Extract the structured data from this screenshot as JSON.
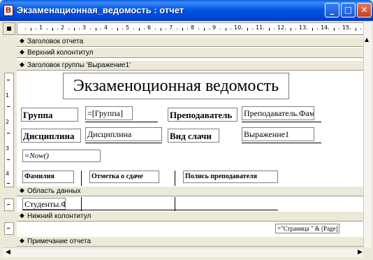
{
  "window": {
    "title": "Экзаменационная_ведомость : отчет",
    "icon_letter": "B",
    "minimize_glyph": "_",
    "maximize_glyph": "□",
    "close_glyph": "✕"
  },
  "ruler": {
    "horizontal_numbers": [
      "1",
      "2",
      "3",
      "4",
      "5",
      "6",
      "7",
      "8",
      "9",
      "10",
      "11",
      "12",
      "13",
      "14",
      "15"
    ],
    "vertical_numbers": [
      "1",
      "2",
      "3",
      "4"
    ]
  },
  "bands": {
    "report_header": "Заголовок отчета",
    "page_header": "Верхний колонтитул",
    "group_header": "Заголовок группы 'Выражение1'",
    "detail": "Область данных",
    "page_footer": "Нижний колонтитул",
    "report_footer": "Примечание отчета"
  },
  "group_header": {
    "title": "Экзаменоционная ведомость",
    "group_label": "Группа",
    "group_field": "=[Группа]",
    "teacher_label": "Преподаватель",
    "teacher_field": "Преподаватель.Фам",
    "discipline_label": "Дисциплина",
    "discipline_field": "Дисциплина",
    "exam_type_label": "Вид слачи",
    "exam_type_field": "Выражение1",
    "date_field": "=Now()",
    "col_surname": "Фамилия",
    "col_mark": "Отметка о сдаче",
    "col_signature": "Полись преподавателя"
  },
  "detail": {
    "student_field": "Студенты.Фа"
  },
  "page_footer": {
    "page_expr": "=\"Страница \" & [Page]"
  },
  "icons": {
    "band_arrow": "◆"
  },
  "colors": {
    "titlebar": "#0058e6",
    "band": "#ece9d8",
    "close_button": "#c4401c"
  }
}
